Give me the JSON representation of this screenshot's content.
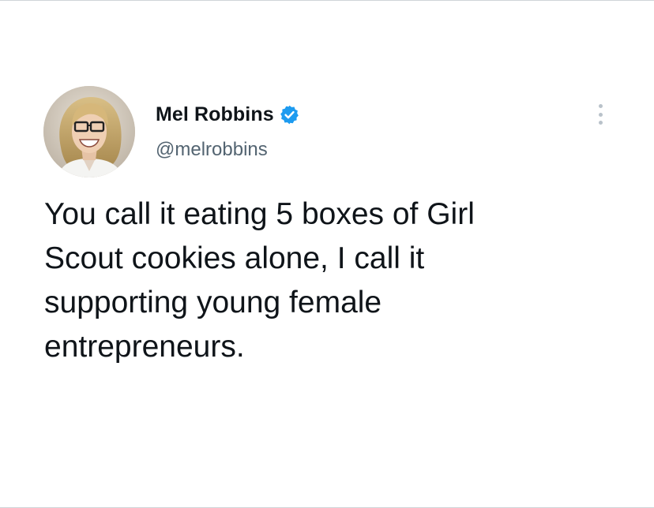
{
  "tweet": {
    "author": {
      "display_name": "Mel Robbins",
      "handle": "@melrobbins",
      "verified": true,
      "avatar_icon": "profile-photo"
    },
    "more_icon": "more-options-icon",
    "text_lines": [
      "You call it eating 5 boxes of Girl",
      "Scout cookies alone, I call it",
      "supporting young female",
      "entrepreneurs."
    ]
  },
  "colors": {
    "text": "#0f1419",
    "secondary_text": "#536471",
    "verified_badge": "#1d9bf0",
    "background": "#ffffff"
  }
}
